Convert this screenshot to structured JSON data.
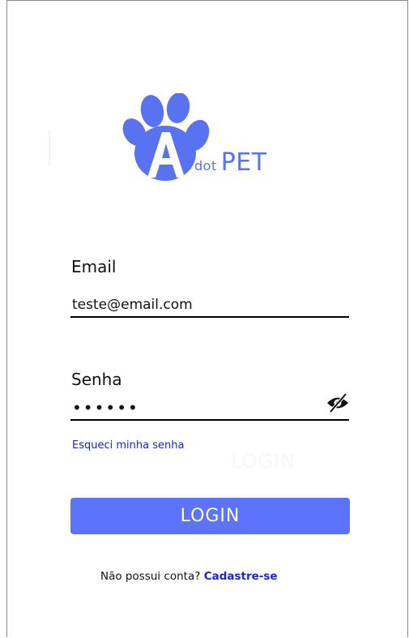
{
  "brand": {
    "dot_text": "dot",
    "pet_text": "PET",
    "logo_color": "#5872f0"
  },
  "form": {
    "email_label": "Email",
    "email_value": "teste@email.com",
    "password_label": "Senha",
    "password_value": "••••••"
  },
  "links": {
    "forgot_password": "Esqueci minha senha"
  },
  "ghost_text": "LOGIN",
  "login_button": {
    "label": "LOGIN",
    "color": "#5c73fb"
  },
  "signup": {
    "prompt": "Não possui conta?",
    "link": "Cadastre-se"
  },
  "icons": {
    "logo": "paw-a-logo-icon",
    "password_toggle": "eye-off-icon"
  }
}
